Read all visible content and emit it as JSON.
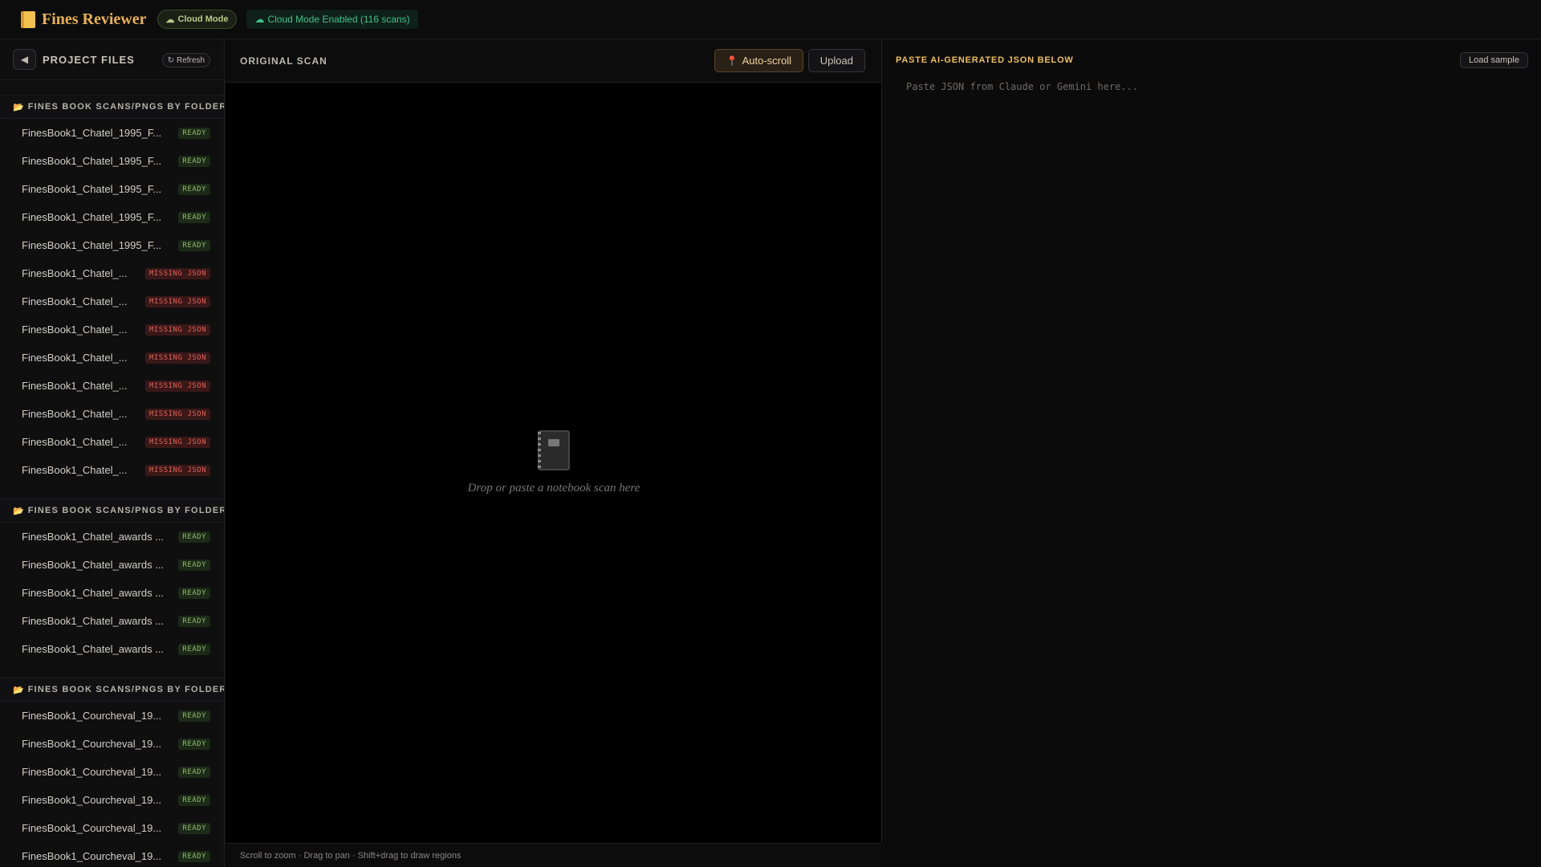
{
  "app": {
    "title": "Fines Reviewer",
    "cloud_mode_label": "Cloud Mode",
    "cloud_status": "Cloud Mode Enabled (116 scans)"
  },
  "sidebar": {
    "collapse_icon": "◀",
    "title": "PROJECT FILES",
    "refresh_label": "Refresh",
    "groups": [
      {
        "name": "FINES BOOK SCANS/PNGS BY FOLDER/",
        "files": [
          {
            "name": "FinesBook1_Chatel_1995_F...",
            "status": "READY"
          },
          {
            "name": "FinesBook1_Chatel_1995_F...",
            "status": "READY"
          },
          {
            "name": "FinesBook1_Chatel_1995_F...",
            "status": "READY"
          },
          {
            "name": "FinesBook1_Chatel_1995_F...",
            "status": "READY"
          },
          {
            "name": "FinesBook1_Chatel_1995_F...",
            "status": "READY"
          },
          {
            "name": "FinesBook1_Chatel_...",
            "status": "MISSING JSON"
          },
          {
            "name": "FinesBook1_Chatel_...",
            "status": "MISSING JSON"
          },
          {
            "name": "FinesBook1_Chatel_...",
            "status": "MISSING JSON"
          },
          {
            "name": "FinesBook1_Chatel_...",
            "status": "MISSING JSON"
          },
          {
            "name": "FinesBook1_Chatel_...",
            "status": "MISSING JSON"
          },
          {
            "name": "FinesBook1_Chatel_...",
            "status": "MISSING JSON"
          },
          {
            "name": "FinesBook1_Chatel_...",
            "status": "MISSING JSON"
          },
          {
            "name": "FinesBook1_Chatel_...",
            "status": "MISSING JSON"
          }
        ]
      },
      {
        "name": "FINES BOOK SCANS/PNGS BY FOLDER/",
        "files": [
          {
            "name": "FinesBook1_Chatel_awards ...",
            "status": "READY"
          },
          {
            "name": "FinesBook1_Chatel_awards ...",
            "status": "READY"
          },
          {
            "name": "FinesBook1_Chatel_awards ...",
            "status": "READY"
          },
          {
            "name": "FinesBook1_Chatel_awards ...",
            "status": "READY"
          },
          {
            "name": "FinesBook1_Chatel_awards ...",
            "status": "READY"
          }
        ]
      },
      {
        "name": "FINES BOOK SCANS/PNGS BY FOLDER/",
        "files": [
          {
            "name": "FinesBook1_Courcheval_19...",
            "status": "READY"
          },
          {
            "name": "FinesBook1_Courcheval_19...",
            "status": "READY"
          },
          {
            "name": "FinesBook1_Courcheval_19...",
            "status": "READY"
          },
          {
            "name": "FinesBook1_Courcheval_19...",
            "status": "READY"
          },
          {
            "name": "FinesBook1_Courcheval_19...",
            "status": "READY"
          },
          {
            "name": "FinesBook1_Courcheval_19...",
            "status": "READY"
          }
        ]
      }
    ]
  },
  "scan_panel": {
    "title": "ORIGINAL SCAN",
    "autoscroll_label": "Auto-scroll",
    "upload_label": "Upload",
    "drop_hint": "Drop or paste a notebook scan here",
    "footer_hint": "Scroll to zoom · Drag to pan · Shift+drag to draw regions"
  },
  "json_panel": {
    "title": "PASTE AI-GENERATED JSON BELOW",
    "load_sample_label": "Load sample",
    "placeholder": "Paste JSON from Claude or Gemini here...",
    "value": ""
  },
  "colors": {
    "accent": "#e9b24b",
    "ready": "#8fb86e",
    "missing": "#e0625a",
    "cloud_green": "#3ec48a"
  },
  "icons": {
    "brand": "notebook-icon",
    "cloud": "cloud-icon",
    "refresh": "refresh-icon",
    "folder": "folder-icon",
    "pin": "pin-icon",
    "drop": "notebook-icon"
  }
}
